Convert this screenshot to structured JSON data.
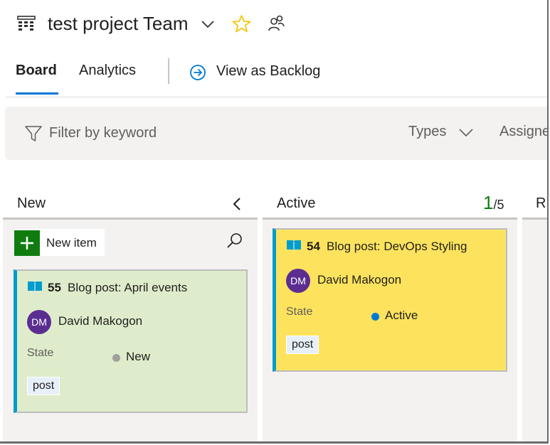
{
  "header": {
    "title": "test project Team",
    "star_color": "#f2c811"
  },
  "tabs": {
    "board": "Board",
    "analytics": "Analytics",
    "view_as_backlog": "View as Backlog",
    "active_color": "#0078d4"
  },
  "filter": {
    "placeholder": "Filter by keyword",
    "types": "Types",
    "assigned": "Assigne"
  },
  "columns": {
    "new": {
      "title": "New",
      "new_item": "New item"
    },
    "active": {
      "title": "Active",
      "wip_count": "1",
      "wip_limit": "/5"
    },
    "resolved": {
      "title": "R"
    }
  },
  "cards": [
    {
      "id": "55",
      "title": "Blog post: April events",
      "assignee_initials": "DM",
      "assignee": "David Makogon",
      "state_label": "State",
      "state": "New",
      "state_color": "#a19f9d",
      "tag": "post",
      "card_color": "#deeccb"
    },
    {
      "id": "54",
      "title": "Blog post: DevOps Styling",
      "assignee_initials": "DM",
      "assignee": "David Makogon",
      "state_label": "State",
      "state": "Active",
      "state_color": "#0078d4",
      "tag": "post",
      "card_color": "#fde35d"
    }
  ]
}
